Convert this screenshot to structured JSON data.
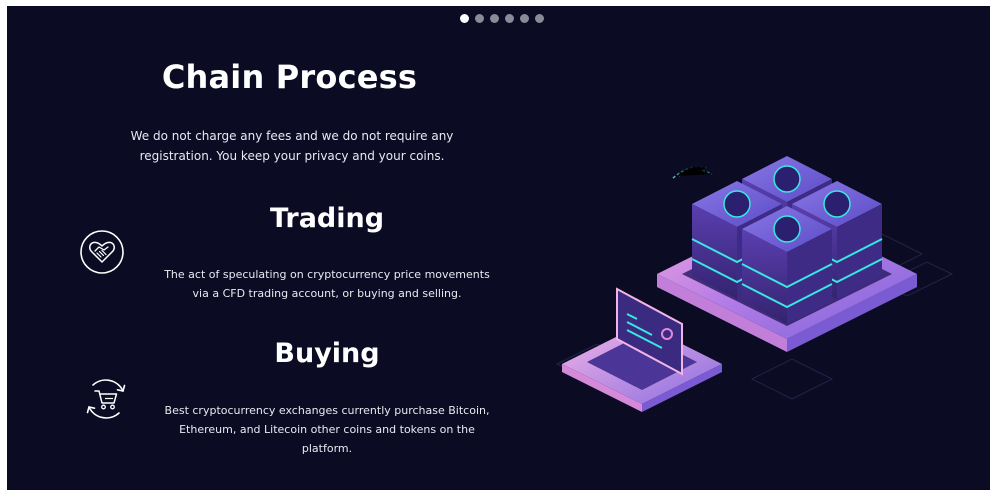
{
  "slider": {
    "dots": [
      {
        "active": true
      },
      {
        "active": false
      },
      {
        "active": false
      },
      {
        "active": false
      },
      {
        "active": false
      },
      {
        "active": false
      }
    ]
  },
  "hero": {
    "title": "Chain Process",
    "intro_line1": "We do not charge any fees and we do not require any",
    "intro_line2": "registration. You keep your privacy and your coins."
  },
  "features": [
    {
      "icon": "handshake-heart-icon",
      "title": "Trading",
      "desc_line1": "The act of speculating on cryptocurrency price movements",
      "desc_line2": "via a CFD trading account, or buying and selling."
    },
    {
      "icon": "shopping-cart-icon",
      "title": "Buying",
      "desc_line1": "Best cryptocurrency exchanges currently purchase Bitcoin,",
      "desc_line2": "Ethereum, and Litecoin other coins and tokens on the",
      "desc_line3": "platform."
    }
  ],
  "colors": {
    "background": "#0b0b23",
    "text": "#ffffff",
    "accent_cyan": "#39e6e0",
    "accent_purple": "#6b3fd6",
    "accent_pink": "#e28ad8"
  },
  "illustration": {
    "icon": "crypto-server-illustration"
  }
}
